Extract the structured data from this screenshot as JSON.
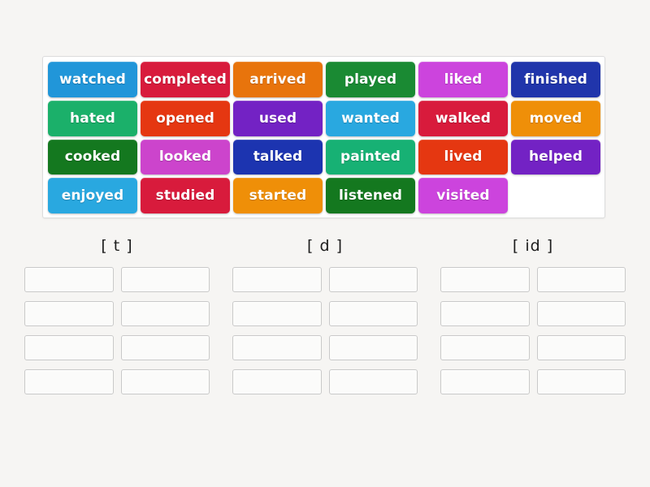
{
  "activity": {
    "type": "drag-and-drop-sorting",
    "background_color": "#f6f5f3"
  },
  "word_bank": {
    "panel_background": "#ffffff",
    "rows": [
      [
        {
          "label": "watched",
          "color": "#2196d9"
        },
        {
          "label": "completed",
          "color": "#d81b3c"
        },
        {
          "label": "arrived",
          "color": "#e8740c"
        },
        {
          "label": "played",
          "color": "#1a8a33"
        },
        {
          "label": "liked",
          "color": "#cc44dd"
        },
        {
          "label": "finished",
          "color": "#2035ab"
        }
      ],
      [
        {
          "label": "hated",
          "color": "#1bb06a"
        },
        {
          "label": "opened",
          "color": "#e53711"
        },
        {
          "label": "used",
          "color": "#7322c4"
        },
        {
          "label": "wanted",
          "color": "#29a8e0"
        },
        {
          "label": "walked",
          "color": "#d81b3c"
        },
        {
          "label": "moved",
          "color": "#ef8f08"
        }
      ],
      [
        {
          "label": "cooked",
          "color": "#14781f"
        },
        {
          "label": "looked",
          "color": "#cc44cc"
        },
        {
          "label": "talked",
          "color": "#1c34b0"
        },
        {
          "label": "painted",
          "color": "#17b174"
        },
        {
          "label": "lived",
          "color": "#e53711"
        },
        {
          "label": "helped",
          "color": "#7322c4"
        }
      ],
      [
        {
          "label": "enjoyed",
          "color": "#29a8e0"
        },
        {
          "label": "studied",
          "color": "#d81b3c"
        },
        {
          "label": "started",
          "color": "#ef8f08"
        },
        {
          "label": "listened",
          "color": "#14781f"
        },
        {
          "label": "visited",
          "color": "#cc44dd"
        },
        {
          "label": "",
          "color": "transparent",
          "empty": true
        }
      ]
    ]
  },
  "answer_columns": [
    {
      "heading": "[ t ]",
      "rows": 4,
      "slots_per_row": 2
    },
    {
      "heading": "[ d ]",
      "rows": 4,
      "slots_per_row": 2
    },
    {
      "heading": "[ id ]",
      "rows": 4,
      "slots_per_row": 2
    }
  ]
}
